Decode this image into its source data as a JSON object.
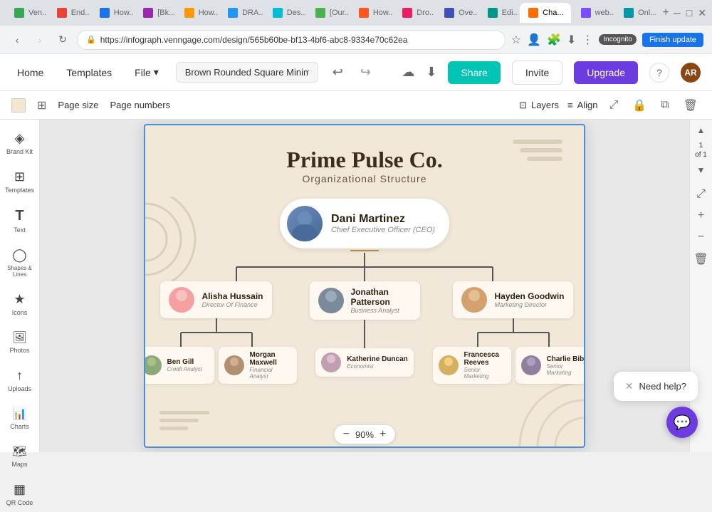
{
  "browser": {
    "tabs": [
      {
        "id": "t1",
        "favicon_color": "#34a853",
        "label": "Ven...",
        "active": false
      },
      {
        "id": "t2",
        "favicon_color": "#ea4335",
        "label": "End...",
        "active": false
      },
      {
        "id": "t3",
        "favicon_color": "#1a73e8",
        "label": "How...",
        "active": false
      },
      {
        "id": "t4",
        "favicon_color": "#9c27b0",
        "label": "[Bk...",
        "active": false
      },
      {
        "id": "t5",
        "favicon_color": "#ff9800",
        "label": "How...",
        "active": false
      },
      {
        "id": "t6",
        "favicon_color": "#2196f3",
        "label": "DRA...",
        "active": false
      },
      {
        "id": "t7",
        "favicon_color": "#00bcd4",
        "label": "Des...",
        "active": false
      },
      {
        "id": "t8",
        "favicon_color": "#4caf50",
        "label": "[Our...",
        "active": false
      },
      {
        "id": "t9",
        "favicon_color": "#ff5722",
        "label": "How...",
        "active": false
      },
      {
        "id": "t10",
        "favicon_color": "#e91e63",
        "label": "Dro...",
        "active": false
      },
      {
        "id": "t11",
        "favicon_color": "#3f51b5",
        "label": "Ove...",
        "active": false
      },
      {
        "id": "t12",
        "favicon_color": "#009688",
        "label": "Edi...",
        "active": false
      },
      {
        "id": "t13",
        "favicon_color": "#ff6f00",
        "label": "Cha...",
        "active": true
      },
      {
        "id": "t14",
        "favicon_color": "#7c4dff",
        "label": "web...",
        "active": false
      },
      {
        "id": "t15",
        "favicon_color": "#0097a7",
        "label": "Onl...",
        "active": false
      }
    ],
    "url": "https://infograph.venngage.com/design/565b60be-bf13-4bf6-abc8-9334e70c62ea",
    "incognito": "Incognito",
    "finish_update": "Finish update"
  },
  "app": {
    "home": "Home",
    "templates": "Templates",
    "file": "File",
    "design_name": "Brown Rounded Square Minimalist...",
    "share": "Share",
    "invite": "Invite",
    "upgrade": "Upgrade"
  },
  "secondary_toolbar": {
    "page_size": "Page size",
    "page_numbers": "Page numbers",
    "layers": "Layers",
    "align": "Align"
  },
  "sidebar": {
    "items": [
      {
        "id": "brand-kit",
        "icon": "◈",
        "label": "Brand Kit"
      },
      {
        "id": "templates",
        "icon": "⊞",
        "label": "Templates"
      },
      {
        "id": "text",
        "icon": "T",
        "label": "Text"
      },
      {
        "id": "shapes",
        "icon": "◯",
        "label": "Shapes & Lines"
      },
      {
        "id": "icons",
        "icon": "★",
        "label": "Icons"
      },
      {
        "id": "photos",
        "icon": "🖼",
        "label": "Photos"
      },
      {
        "id": "uploads",
        "icon": "↑",
        "label": "Uploads"
      },
      {
        "id": "charts",
        "icon": "📊",
        "label": "Charts"
      },
      {
        "id": "maps",
        "icon": "🗺",
        "label": "Maps"
      },
      {
        "id": "qr-code",
        "icon": "▦",
        "label": "QR Code"
      }
    ]
  },
  "canvas": {
    "title": "Prime Pulse Co.",
    "subtitle": "Organizational Structure",
    "ceo": {
      "name": "Dani Martinez",
      "title": "Chief Executive Officer (CEO)"
    },
    "managers": [
      {
        "name": "Alisha Hussain",
        "title": "Director Of Finance",
        "color": "#f4a0a0"
      },
      {
        "name": "Jonathan Patterson",
        "title": "Business Analyst",
        "color": "#7a8a9a"
      },
      {
        "name": "Hayden Goodwin",
        "title": "Marketing Director",
        "color": "#d4a070"
      }
    ],
    "subordinates": [
      [
        {
          "name": "Ben Gill",
          "title": "Credit Analyst",
          "color": "#8aaa7a"
        },
        {
          "name": "Morgan Maxwell",
          "title": "Financial Analyst",
          "color": "#b09070"
        }
      ],
      [
        {
          "name": "Katherine Duncan",
          "title": "Economist",
          "color": "#c0a0b0"
        }
      ],
      [
        {
          "name": "Francesca Reeves",
          "title": "Senior Marketing",
          "color": "#d4b060"
        },
        {
          "name": "Charlie Bibi",
          "title": "Senior Marketing",
          "color": "#9080a0"
        }
      ]
    ]
  },
  "zoom": {
    "value": "90%",
    "minus": "−",
    "plus": "+"
  },
  "pagination": {
    "current": "1",
    "of": "of 1"
  },
  "help": {
    "popup_text": "Need help?",
    "close": "✕"
  },
  "user": {
    "initials": "AR"
  }
}
